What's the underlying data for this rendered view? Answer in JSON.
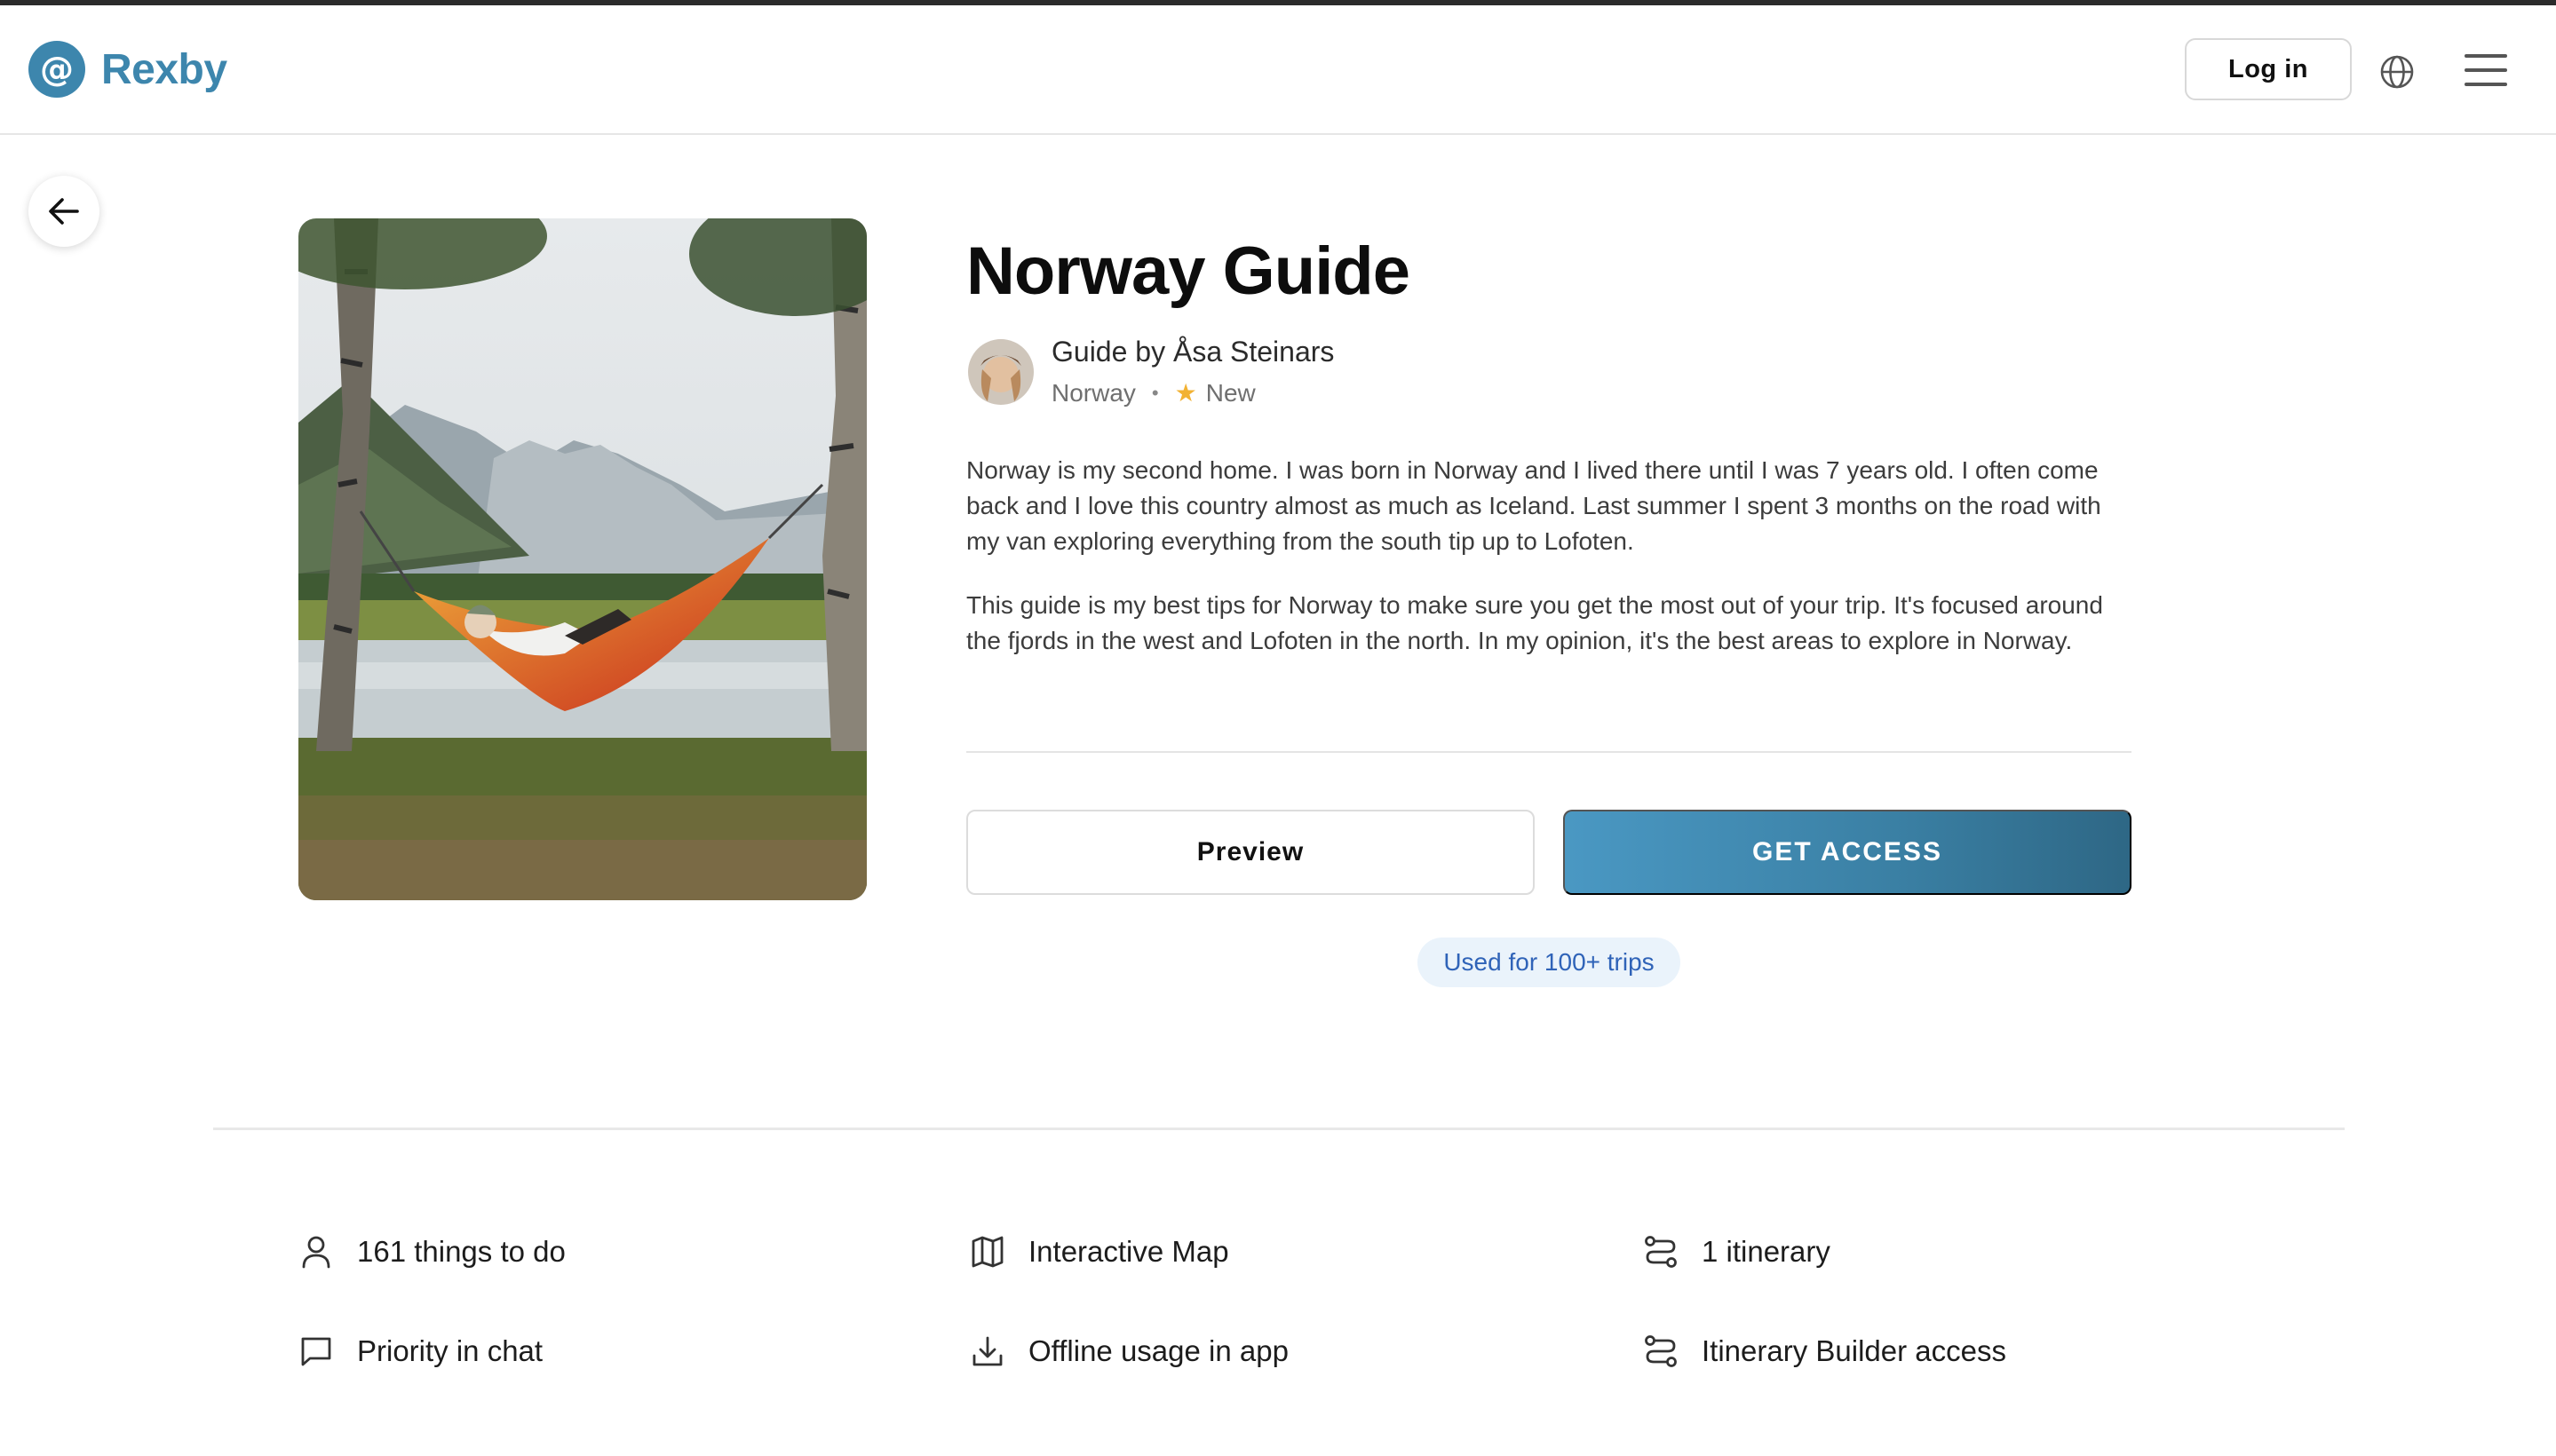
{
  "header": {
    "logo_mark": "@",
    "logo_text": "Rexby",
    "login_label": "Log in",
    "globe_icon": "globe-icon",
    "menu_icon": "hamburger-menu-icon"
  },
  "back": {
    "icon": "arrow-left-icon"
  },
  "guide": {
    "title": "Norway Guide",
    "author": "Guide by Åsa Steinars",
    "location": "Norway",
    "separator": "•",
    "status": "New",
    "description": [
      "Norway is my second home. I was born in Norway and I lived there until I was 7 years old. I often come back and I love this country almost as much as Iceland. Last summer I spent 3 months on the road with my van exploring everything from the south tip up to Lofoten.",
      "This guide is my best tips for Norway to make sure you get the most out of your trip. It's focused around the fjords in the west and Lofoten in the north. In my opinion, it's the best areas to explore in Norway."
    ],
    "preview_label": "Preview",
    "access_label": "GET ACCESS",
    "usage_badge": "Used for 100+ trips"
  },
  "features": [
    {
      "icon": "person-icon",
      "label": "161 things to do"
    },
    {
      "icon": "map-icon",
      "label": "Interactive Map"
    },
    {
      "icon": "route-icon",
      "label": "1 itinerary"
    },
    {
      "icon": "chat-bubble-icon",
      "label": "Priority in chat"
    },
    {
      "icon": "download-icon",
      "label": "Offline usage in app"
    },
    {
      "icon": "route-icon",
      "label": "Itinerary Builder access"
    }
  ],
  "colors": {
    "brand": "#3d86ad",
    "access_gradient_start": "#4a98c3",
    "access_gradient_end": "#2e6785",
    "badge_bg": "#eaf3fb",
    "badge_text": "#2f63b8",
    "star": "#f2b233"
  }
}
